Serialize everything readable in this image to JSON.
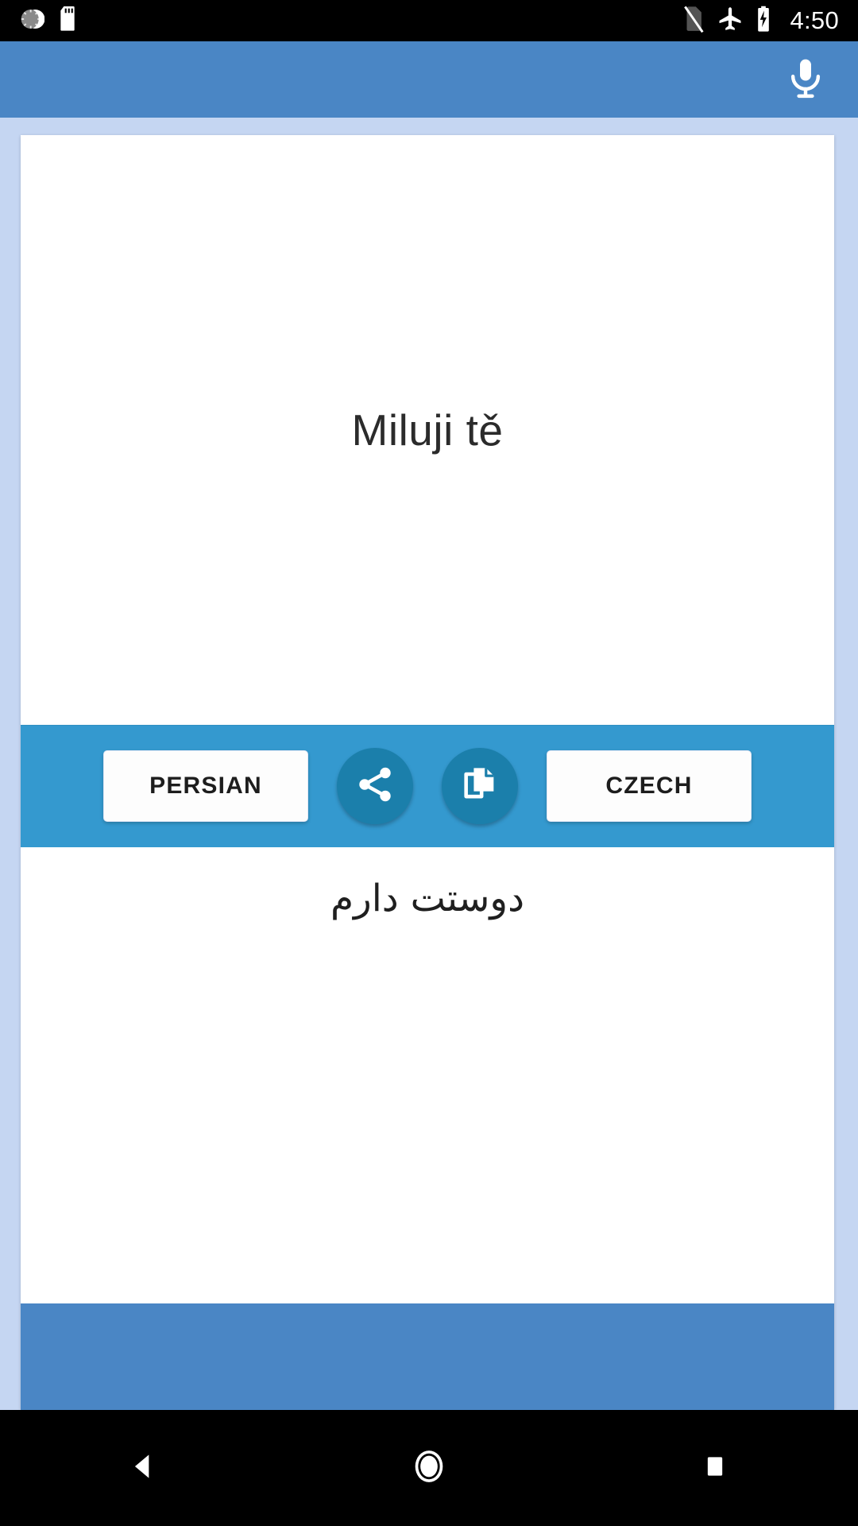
{
  "status_bar": {
    "time": "4:50",
    "left_icons": [
      {
        "name": "alarm-gauge-icon",
        "label": "alarm"
      },
      {
        "name": "sd-card-icon",
        "label": "sd card"
      }
    ],
    "right_icons": [
      {
        "name": "no-sim-icon",
        "label": "no sim"
      },
      {
        "name": "airplane-mode-icon",
        "label": "airplane mode"
      },
      {
        "name": "battery-charging-icon",
        "label": "battery charging"
      }
    ]
  },
  "app_bar": {
    "title": "",
    "mic_label": "speak",
    "background": "#4a86c5"
  },
  "translator": {
    "source_text": "Miluji tě",
    "target_text": "دوستت دارم",
    "source_language": "CZECH",
    "target_language": "PERSIAN",
    "left_button_label": "PERSIAN",
    "right_button_label": "CZECH",
    "share_label": "share",
    "copy_label": "copy",
    "bar_color": "#3499cf",
    "round_button_color": "#1b7fab",
    "card_background": "#ffffff",
    "page_background": "#c5d6f2"
  },
  "nav_bar": {
    "back_label": "back",
    "home_label": "home",
    "recents_label": "recent apps"
  }
}
